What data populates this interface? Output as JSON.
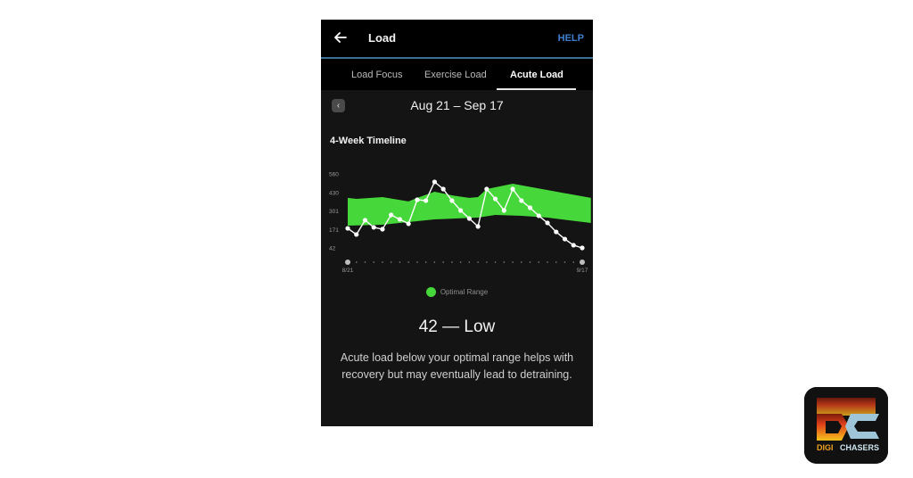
{
  "appbar": {
    "title": "Load",
    "help_label": "HELP",
    "back_icon": "arrow-left-icon"
  },
  "tabs": [
    {
      "label": "Load Focus",
      "active": false
    },
    {
      "label": "Exercise Load",
      "active": false
    },
    {
      "label": "Acute Load",
      "active": true
    }
  ],
  "date_nav": {
    "prev_icon": "chevron-left-icon",
    "range": "Aug 21 – Sep 17"
  },
  "section_title": "4-Week Timeline",
  "legend": {
    "label": "Optimal Range",
    "color": "#46d83a"
  },
  "status": "42 — Low",
  "description": "Acute load below your optimal range helps with recovery but may eventually lead to detraining.",
  "colors": {
    "band": "#46d83a",
    "line": "#ffffff",
    "background": "#141414",
    "help": "#3f7fd0"
  },
  "watermark": {
    "text_top": "DIGI",
    "text_bottom": "CHASERS"
  },
  "chart_data": {
    "type": "line",
    "title": "4-Week Timeline",
    "xlabel": "",
    "ylabel": "",
    "x_tick_labels": [
      "8/21",
      "9/17"
    ],
    "y_tick_labels": [
      "560",
      "430",
      "301",
      "171",
      "42"
    ],
    "y_ticks": [
      560,
      430,
      301,
      171,
      42
    ],
    "ylim": [
      42,
      560
    ],
    "days": 28,
    "grid": false,
    "legend_position": "bottom-center",
    "series": [
      {
        "name": "Acute Load",
        "values": [
          179,
          136,
          236,
          186,
          173,
          273,
          242,
          211,
          379,
          373,
          504,
          454,
          373,
          304,
          248,
          192,
          454,
          385,
          304,
          454,
          373,
          323,
          267,
          217,
          154,
          104,
          61,
          42
        ]
      }
    ],
    "band": {
      "name": "Optimal Range",
      "x_days": [
        0,
        1,
        4,
        7,
        8,
        10,
        12,
        14,
        15,
        16,
        19,
        28
      ],
      "upper": [
        392,
        385,
        398,
        367,
        392,
        435,
        410,
        392,
        398,
        454,
        491,
        392
      ],
      "lower_x_days": [
        0,
        4,
        7,
        10,
        15,
        17,
        20,
        23,
        28
      ],
      "lower": [
        198,
        204,
        223,
        242,
        254,
        273,
        267,
        254,
        217
      ]
    }
  }
}
